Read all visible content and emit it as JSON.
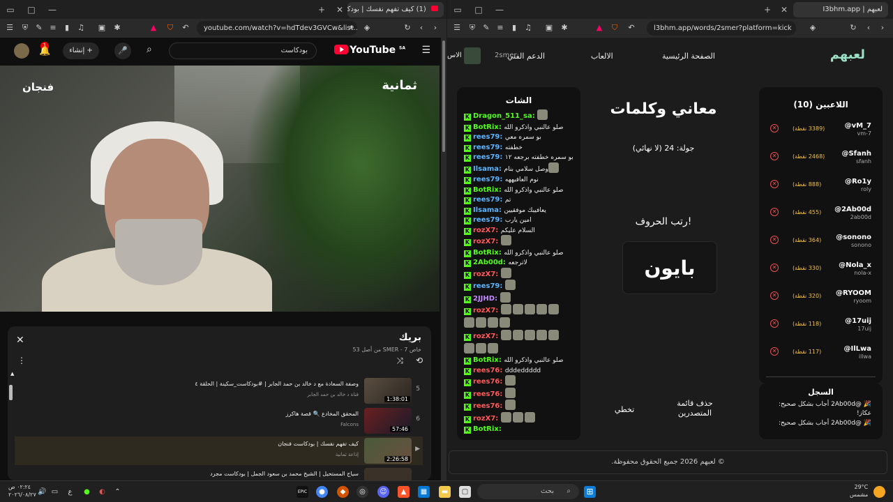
{
  "left_browser": {
    "tab_title": "(1) كيف تفهم نفسك | بودكاست",
    "url": "youtube.com/watch?v=hdTdev3GVCw&list...",
    "youtube": {
      "logo": "YouTube",
      "logo_region": "SA",
      "search_value": "بودكاست",
      "create_label": "إنشاء",
      "notif_count": "1",
      "video_overlay_right": "ثمانية",
      "video_overlay_left": "فنجان",
      "playlist": {
        "title": "بريك",
        "subtitle": "خاص SMER - 7 من أصل 53",
        "items": [
          {
            "num": "5",
            "title": "وصفة السعادة مع د خالد بن حمد الجابر | #بودكاست_سكينة | الحلقة ٤",
            "channel": "قناة د خالد بن حمد الجابر",
            "duration": "1:38:01"
          },
          {
            "num": "6",
            "title": "المحقق المخادع 🔍 قصة هاكرز",
            "channel": "Falcons",
            "duration": "57:46"
          },
          {
            "num": "▶",
            "title": "كيف تفهم نفسك | بودكاست فنجان",
            "channel": "إذاعة ثمانية",
            "duration": "2:26:58"
          },
          {
            "num": "",
            "title": "سياج المستحيل | الشيخ محمد بن سعود الجمل | بودكاست مجرد",
            "channel": "",
            "duration": ""
          }
        ]
      }
    }
  },
  "right_browser": {
    "tab_title": "لعبهم | I3bhm.app",
    "url": "l3bhm.app/words/2smer?platform=kick",
    "nav": {
      "logo": "لعبهم",
      "home": "الصفحة الرئيسية",
      "games": "الالعاب",
      "support": "الدعم الفني",
      "user": "2smer",
      "cut": "الاس"
    },
    "players": {
      "header": "اللاعبين (10)",
      "list": [
        {
          "name": "@vM_7",
          "user": "vm-7",
          "points": "(3389 نقطة)"
        },
        {
          "name": "@Sfanh",
          "user": "sfanh",
          "points": "(2468 نقطة)"
        },
        {
          "name": "@Ro1y",
          "user": "roly",
          "points": "(888 نقطة)"
        },
        {
          "name": "@2Ab00d",
          "user": "2ab00d",
          "points": "(455 نقطة)"
        },
        {
          "name": "@sonono",
          "user": "sonono",
          "points": "(364 نقطة)"
        },
        {
          "name": "@Nola_x",
          "user": "nola-x",
          "points": "(330 نقطة)"
        },
        {
          "name": "@RYOOM",
          "user": "ryoom",
          "points": "(320 نقطة)"
        },
        {
          "name": "@17uij",
          "user": "17uij",
          "points": "(118 نقطة)"
        },
        {
          "name": "@IlLwa",
          "user": "illwa",
          "points": "(117 نقطة)"
        }
      ]
    },
    "log": {
      "header": "السجل",
      "entries": [
        "🎉 @2Ab00d أجاب بشكل صحيح: عكاز!",
        "🎉 @2Ab00d أجاب بشكل صحيح:"
      ]
    },
    "game": {
      "title": "معاني وكلمات",
      "round": "جولة: 24 (لا نهائي)",
      "prompt": "رتب الحروف!",
      "word": "بايون",
      "btn_clear": "حذف قائمة المتصدرين",
      "btn_skip": "تخطي"
    },
    "chat": {
      "header": "الشات",
      "messages": [
        {
          "user": "Dragon_511_sa:",
          "text": "",
          "color": "g",
          "emotes": 1
        },
        {
          "user": "BotRix:",
          "text": "صلو عالنبي واذكرو الله",
          "color": "g",
          "emotes": 0
        },
        {
          "user": "rees79:",
          "text": "بو سمره معي",
          "color": "b",
          "emotes": 0
        },
        {
          "user": "rees79:",
          "text": "خطفته",
          "color": "b",
          "emotes": 0
        },
        {
          "user": "rees79:",
          "text": "بو سمره خطفته برجعه ١٢",
          "color": "b",
          "emotes": 0
        },
        {
          "user": "Ilsama:",
          "text": "وصل سلامي بنام",
          "color": "b",
          "emotes": 1
        },
        {
          "user": "rees79:",
          "text": "نوم العافيههه",
          "color": "b",
          "emotes": 0
        },
        {
          "user": "BotRix:",
          "text": "صلو عالنبي واذكرو الله",
          "color": "g",
          "emotes": 0
        },
        {
          "user": "rees79:",
          "text": "تم",
          "color": "b",
          "emotes": 0
        },
        {
          "user": "Ilsama:",
          "text": "يعافيبك موفقيين",
          "color": "b",
          "emotes": 0
        },
        {
          "user": "rees79:",
          "text": "امين يارب",
          "color": "b",
          "emotes": 0
        },
        {
          "user": "rozX7:",
          "text": "السلام عليكم",
          "color": "r",
          "emotes": 0
        },
        {
          "user": "rozX7:",
          "text": "",
          "color": "r",
          "emotes": 1
        },
        {
          "user": "BotRix:",
          "text": "صلو عالنبي واذكرو الله",
          "color": "g",
          "emotes": 0
        },
        {
          "user": "2Ab00d:",
          "text": "لاترجعه",
          "color": "g",
          "emotes": 0
        },
        {
          "user": "rozX7:",
          "text": "",
          "color": "r",
          "emotes": 1
        },
        {
          "user": "rees79:",
          "text": "",
          "color": "b",
          "emotes": 1
        },
        {
          "user": "2JJHD:",
          "text": "",
          "color": "p",
          "emotes": 1
        },
        {
          "user": "rozX7:",
          "text": "",
          "color": "r",
          "emotes": 9
        },
        {
          "user": "rozX7:",
          "text": "",
          "color": "r",
          "emotes": 8
        },
        {
          "user": "BotRix:",
          "text": "صلو عالنبي واذكرو الله",
          "color": "g",
          "emotes": 0
        },
        {
          "user": "rees76:",
          "text": "dddeddddd",
          "color": "r",
          "emotes": 0
        },
        {
          "user": "rees76:",
          "text": "",
          "color": "r",
          "emotes": 1
        },
        {
          "user": "rees76:",
          "text": "",
          "color": "r",
          "emotes": 1
        },
        {
          "user": "rees76:",
          "text": "",
          "color": "r",
          "emotes": 1
        },
        {
          "user": "rozX7:",
          "text": "",
          "color": "r",
          "emotes": 3
        },
        {
          "user": "BotRix:",
          "text": "",
          "color": "g",
          "emotes": 0
        }
      ]
    },
    "footer": "© لعبهم 2026 جميع الحقوق محفوظة."
  },
  "taskbar": {
    "clock_time": "٠٢:٢٤ ص",
    "clock_date": "٢٠٢٦/٠٨/٢٧",
    "search_placeholder": "بحث",
    "weather_temp": "29°C",
    "weather_desc": "مشمس",
    "lang": "ع"
  },
  "colors": {
    "accent_kick": "#53fc18",
    "yt_red": "#ff0033",
    "points": "#f0c040"
  }
}
